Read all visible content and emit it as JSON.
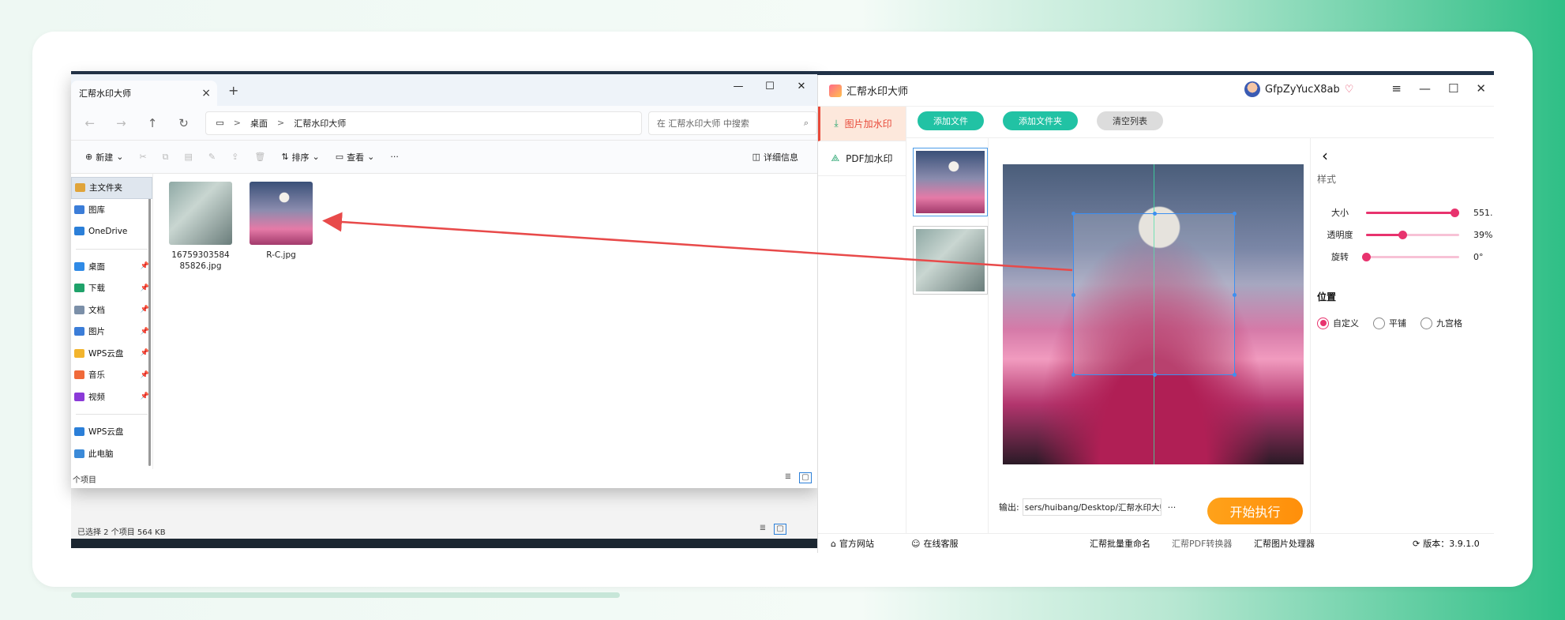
{
  "explorer": {
    "tab_title": "汇帮水印大师",
    "tab_close": "×",
    "new_tab": "+",
    "window_controls": [
      "—",
      "☐",
      "✕"
    ],
    "nav": {
      "back": "←",
      "forward": "→",
      "up": "↑",
      "refresh": "↻"
    },
    "breadcrumb": [
      "桌面",
      "汇帮水印大师"
    ],
    "breadcrumb_sep": ">",
    "search_placeholder": "在 汇帮水印大师 中搜索",
    "toolbar": {
      "new": "新建",
      "sort": "排序",
      "view": "查看",
      "more": "···",
      "details": "详细信息"
    },
    "sidebar": [
      {
        "label": "主文件夹",
        "color": "#e0a43a",
        "pin": false
      },
      {
        "label": "图库",
        "color": "#3b7dd8",
        "pin": false
      },
      {
        "label": "OneDrive",
        "color": "#2b7fd8",
        "pin": false
      },
      {
        "label": "桌面",
        "color": "#2f8ae6",
        "pin": true
      },
      {
        "label": "下载",
        "color": "#1fa26a",
        "pin": true
      },
      {
        "label": "文档",
        "color": "#7b8fa8",
        "pin": true
      },
      {
        "label": "图片",
        "color": "#3b7dd8",
        "pin": true
      },
      {
        "label": "WPS云盘",
        "color": "#f2b42d",
        "pin": true
      },
      {
        "label": "音乐",
        "color": "#f06a3a",
        "pin": true
      },
      {
        "label": "视频",
        "color": "#8b3ad8",
        "pin": true
      },
      {
        "label": "WPS云盘",
        "color": "#2b7fd8",
        "pin": false
      },
      {
        "label": "此电脑",
        "color": "#3b8ad8",
        "pin": false
      }
    ],
    "files": [
      {
        "name": "1675930358485826.jpg"
      },
      {
        "name": "R-C.jpg"
      }
    ],
    "footer_status": "个项目",
    "back_status": "已选择 2 个项目  564 KB"
  },
  "app": {
    "title": "汇帮水印大师",
    "username": "GfpZyYucX8ab",
    "controls": [
      "≡",
      "—",
      "☐",
      "✕"
    ],
    "modes": [
      {
        "label": "图片加水印",
        "active": true
      },
      {
        "label": "PDF加水印",
        "active": false
      }
    ],
    "actions": {
      "add_file": "添加文件",
      "add_folder": "添加文件夹",
      "clear": "清空列表"
    },
    "panel": {
      "style_heading": "样式",
      "position_heading": "位置",
      "sliders": [
        {
          "label": "大小",
          "value_text": "551.",
          "fraction": 0.95
        },
        {
          "label": "透明度",
          "value_text": "39%",
          "fraction": 0.39
        },
        {
          "label": "旋转",
          "value_text": "0°",
          "fraction": 0.0
        }
      ],
      "position_options": [
        {
          "label": "自定义",
          "selected": true
        },
        {
          "label": "平铺",
          "selected": false
        },
        {
          "label": "九宫格",
          "selected": false
        }
      ]
    },
    "output_label": "输出:",
    "output_path": "sers/huibang/Desktop/汇帮水印大师",
    "output_more": "···",
    "start_button": "开始执行",
    "footer": {
      "site": "官方网站",
      "support": "在线客服",
      "links": [
        "汇帮批量重命名",
        "汇帮PDF转换器",
        "汇帮图片处理器"
      ],
      "version": "版本：3.9.1.0"
    },
    "accent": "#e8336e",
    "teal": "#21c2a4",
    "orange": "#ff9a12"
  }
}
